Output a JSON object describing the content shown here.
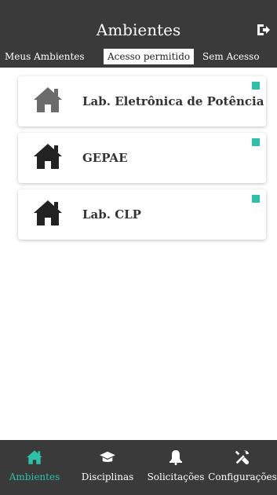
{
  "header": {
    "title": "Ambientes",
    "logout_icon": "logout-icon"
  },
  "tabs": [
    {
      "label": "Meus Ambientes",
      "active": false
    },
    {
      "label": "Acesso permitido",
      "active": true
    },
    {
      "label": "Sem Acesso",
      "active": false
    }
  ],
  "environments": [
    {
      "name": "Lab. Eletrônica de Potência",
      "icon": "home-icon",
      "icon_color": "#6b6b6b",
      "status_color": "#2ec0a8"
    },
    {
      "name": "GEPAE",
      "icon": "home-icon",
      "icon_color": "#222222",
      "status_color": "#2ec0a8"
    },
    {
      "name": "Lab. CLP",
      "icon": "home-icon",
      "icon_color": "#222222",
      "status_color": "#2ec0a8"
    }
  ],
  "bottom_nav": [
    {
      "label": "Ambientes",
      "icon": "home-icon",
      "active": true
    },
    {
      "label": "Disciplinas",
      "icon": "graduation-cap-icon",
      "active": false
    },
    {
      "label": "Solicitações",
      "icon": "bell-icon",
      "active": false
    },
    {
      "label": "Configurações",
      "icon": "tools-icon",
      "active": false
    }
  ],
  "colors": {
    "header_bg": "#3a3a3a",
    "accent": "#2ec0a8"
  }
}
